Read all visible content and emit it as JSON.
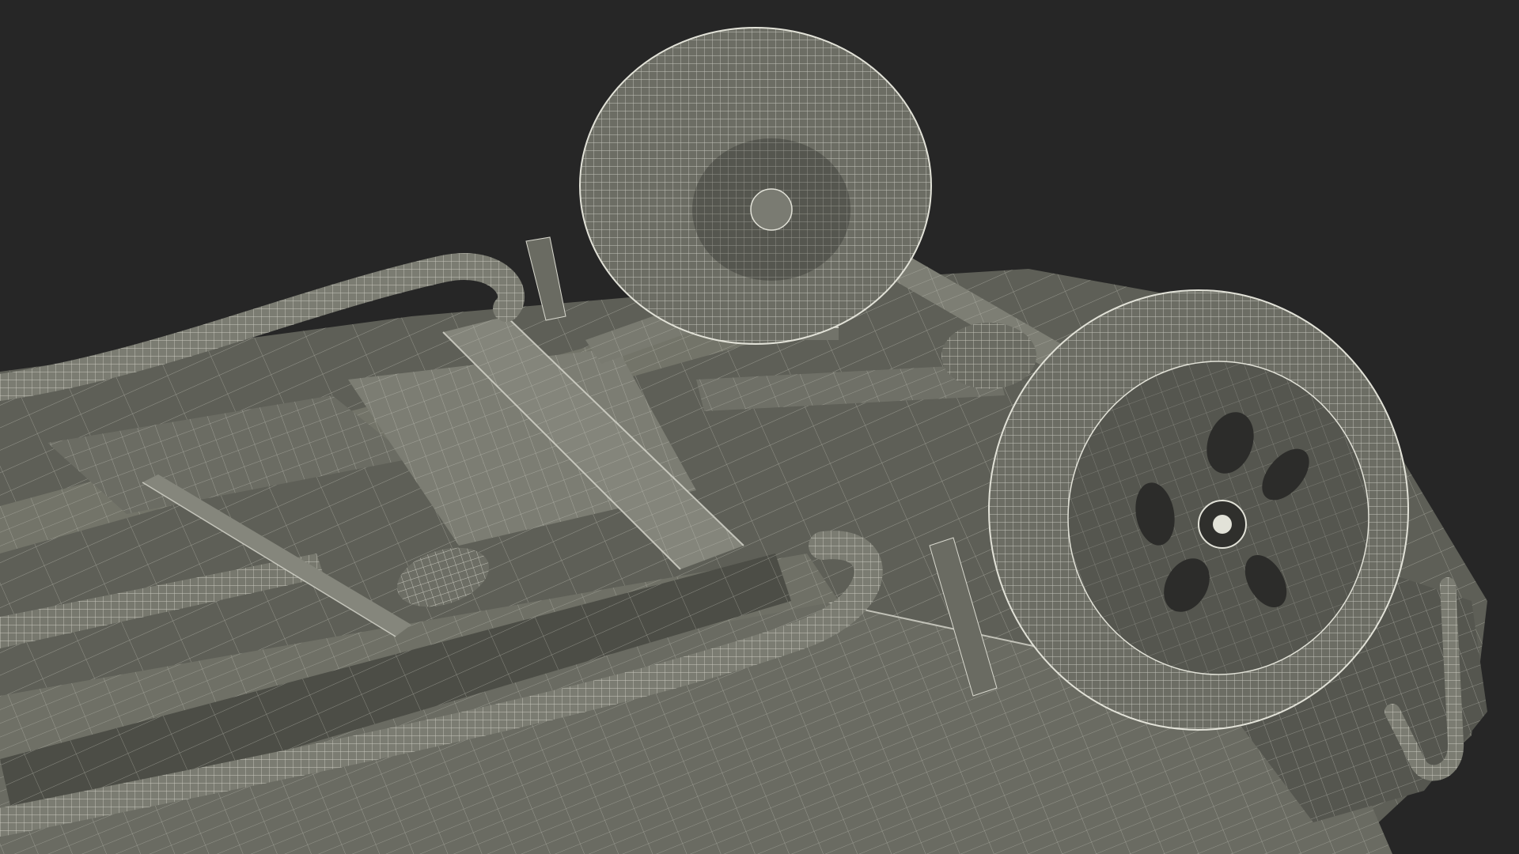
{
  "scene": {
    "subject": "undercarriage-wireframe-render",
    "colors": {
      "background": "#262626",
      "body_fill": "#5e5f57",
      "body_light": "#7a7b72",
      "body_dark": "#3f403a",
      "wire": "#d9d9cf",
      "tire_fill": "#6c6d64"
    }
  }
}
